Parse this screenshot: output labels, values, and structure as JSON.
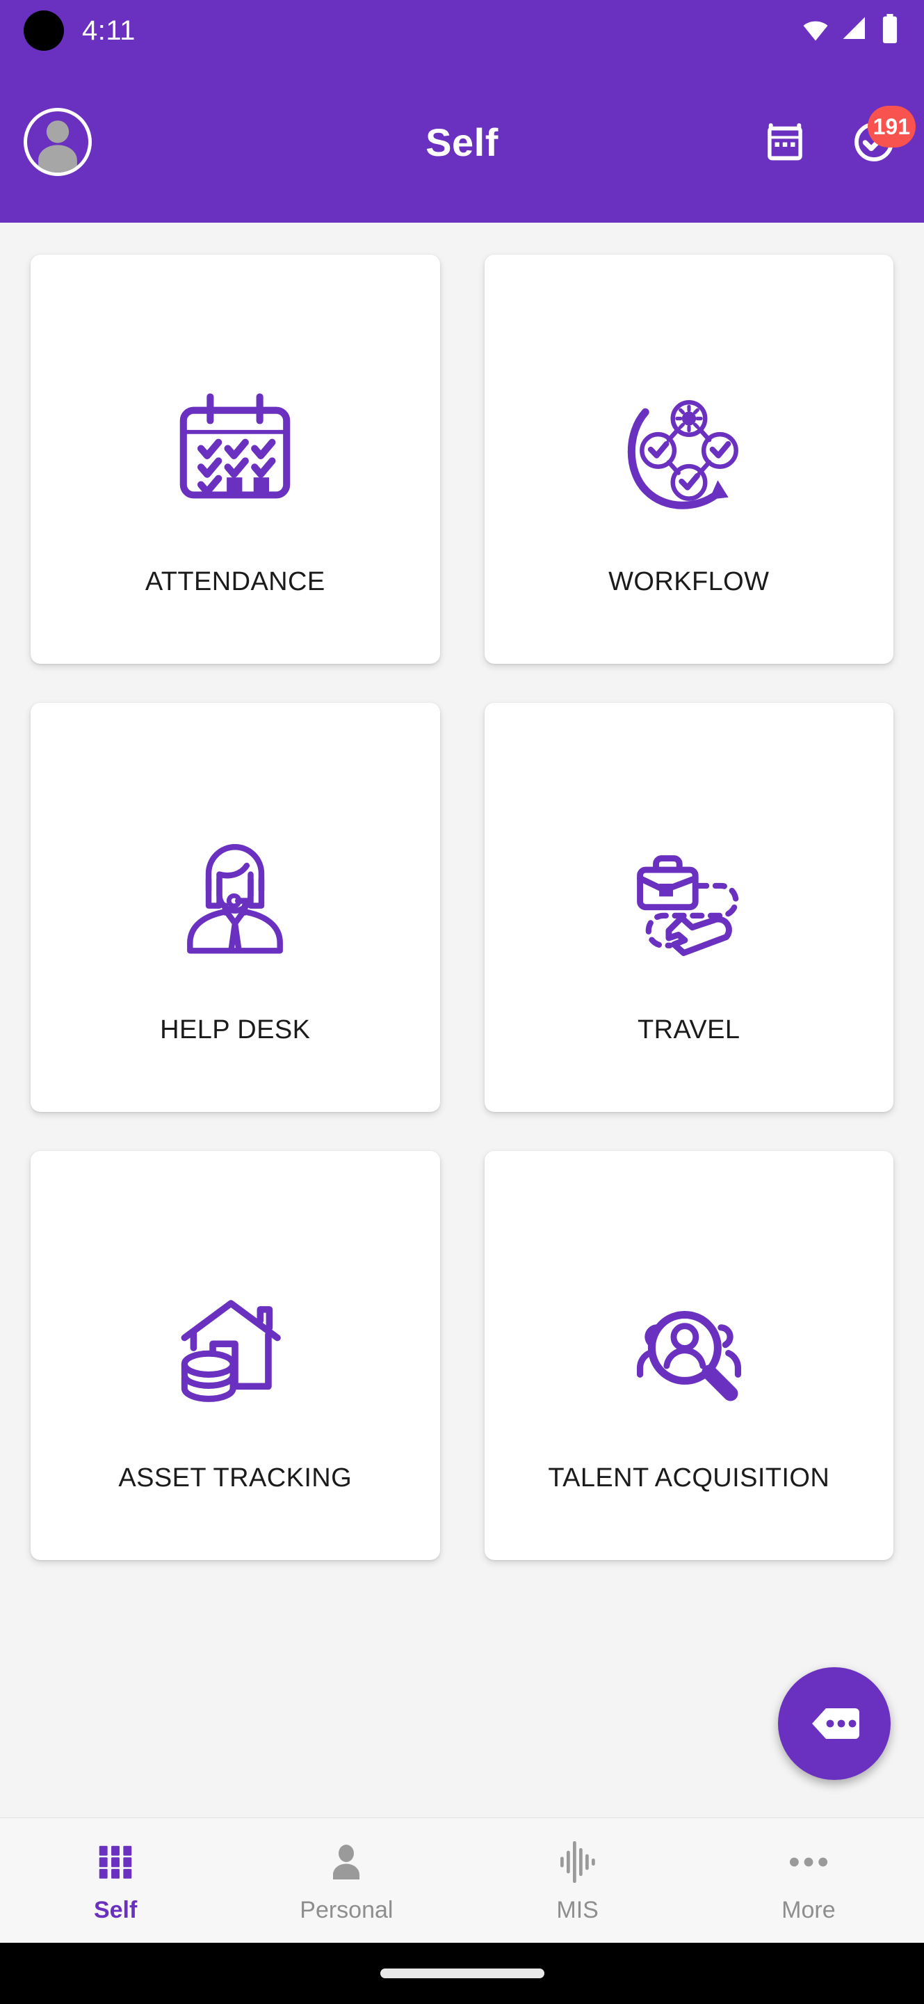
{
  "status_bar": {
    "time": "4:11",
    "icons": [
      "wifi-icon",
      "signal-icon",
      "battery-icon"
    ]
  },
  "app_bar": {
    "title": "Self",
    "avatar_icon": "user-avatar-placeholder",
    "actions": [
      {
        "icon": "calendar-icon",
        "name": "calendar-button"
      },
      {
        "icon": "check-circle-icon",
        "name": "approvals-button",
        "badge": "191"
      }
    ],
    "badge_count": "191"
  },
  "modules": [
    {
      "label": "ATTENDANCE",
      "icon": "calendar-check-icon"
    },
    {
      "label": "WORKFLOW",
      "icon": "workflow-nodes-icon"
    },
    {
      "label": "HELP DESK",
      "icon": "support-agent-icon"
    },
    {
      "label": "TRAVEL",
      "icon": "briefcase-airplane-icon"
    },
    {
      "label": "ASSET TRACKING",
      "icon": "house-coins-icon"
    },
    {
      "label": "TALENT ACQUISITION",
      "icon": "person-search-icon"
    }
  ],
  "fab": {
    "icon": "chat-tag-dots-icon",
    "name": "chat-fab"
  },
  "bottom_nav": {
    "items": [
      {
        "label": "Self",
        "icon": "grid-icon",
        "active": true
      },
      {
        "label": "Personal",
        "icon": "person-icon",
        "active": false
      },
      {
        "label": "MIS",
        "icon": "waveform-icon",
        "active": false
      },
      {
        "label": "More",
        "icon": "dots-icon",
        "active": false
      }
    ]
  },
  "colors": {
    "primary": "#6a30bf",
    "badge": "#f9534f",
    "background": "#f4f4f4",
    "card": "#ffffff",
    "nav_inactive": "#8e8e8e",
    "text": "#1b1b1b"
  }
}
